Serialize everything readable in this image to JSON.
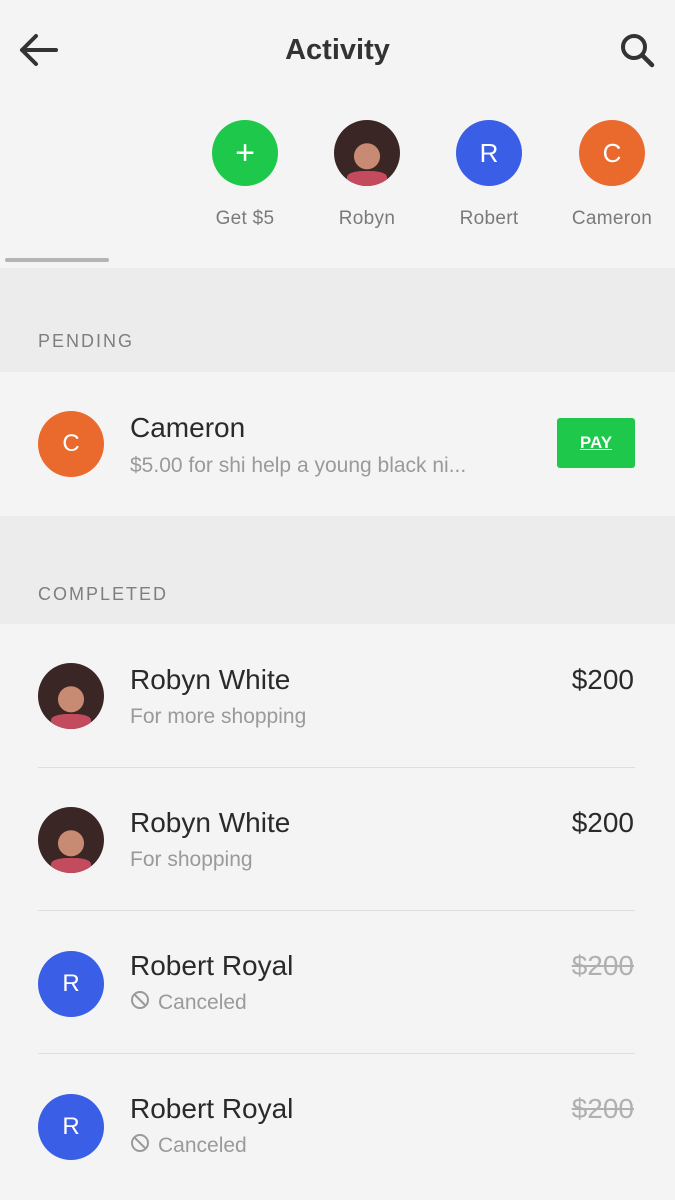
{
  "header": {
    "title": "Activity",
    "back_icon": "arrow-left-icon",
    "search_icon": "search-icon"
  },
  "contacts": [
    {
      "label": "Get $5",
      "glyph": "+",
      "color": "#1ec84a"
    },
    {
      "label": "Robyn",
      "glyph": "",
      "color": "photo"
    },
    {
      "label": "Robert",
      "glyph": "R",
      "color": "#3a5ee6"
    },
    {
      "label": "Cameron",
      "glyph": "C",
      "color": "#ea6a2e"
    }
  ],
  "pending": {
    "label": "PENDING",
    "items": [
      {
        "avatar": "C",
        "name": "Cameron",
        "note": "$5.00 for shi help a young black ni...",
        "action": "PAY"
      }
    ]
  },
  "completed": {
    "label": "COMPLETED",
    "items": [
      {
        "avatar": "photo",
        "name": "Robyn White",
        "note": "For more shopping",
        "amount": "$200",
        "canceled": false
      },
      {
        "avatar": "photo",
        "name": "Robyn White",
        "note": "For shopping",
        "amount": "$200",
        "canceled": false
      },
      {
        "avatar": "R",
        "name": "Robert Royal",
        "note": "Canceled",
        "amount": "$200",
        "canceled": true
      },
      {
        "avatar": "R",
        "name": "Robert Royal",
        "note": "Canceled",
        "amount": "$200",
        "canceled": true
      }
    ]
  },
  "colors": {
    "accent_green": "#1ec84a",
    "blue": "#3a5ee6",
    "orange": "#ea6a2e"
  }
}
